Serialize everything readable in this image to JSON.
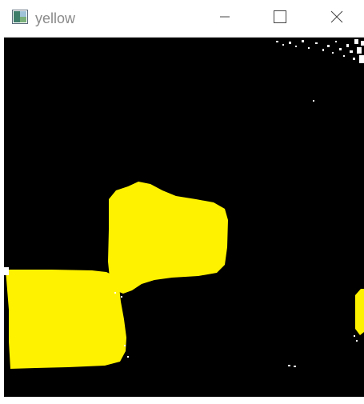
{
  "window": {
    "title": "yellow"
  },
  "icons": {
    "app": "image-window-icon",
    "minimize": "minimize-icon",
    "maximize": "maximize-icon",
    "close": "close-icon"
  },
  "colors": {
    "mask_background": "#000000",
    "mask_foreground": "#fff200",
    "noise": "#ffffff"
  }
}
